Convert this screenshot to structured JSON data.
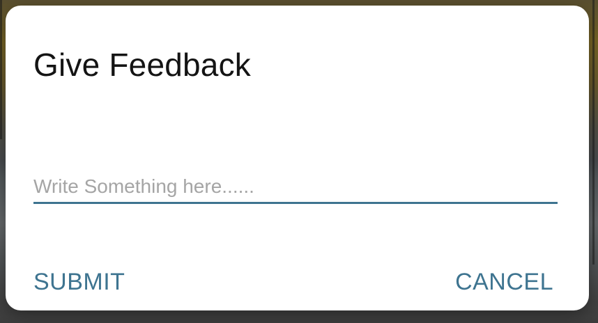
{
  "dialog": {
    "title": "Give Feedback",
    "input": {
      "placeholder": "Write Something here......",
      "value": ""
    },
    "submit_label": "SUBMIT",
    "cancel_label": "CANCEL"
  },
  "colors": {
    "accent": "#3e7490",
    "title": "#141414",
    "placeholder": "#a5a5a5",
    "dialog_bg": "#ffffff"
  }
}
